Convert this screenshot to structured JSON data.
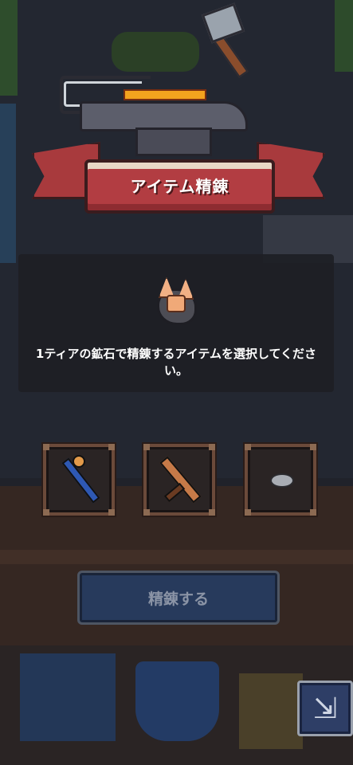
{
  "header": {
    "title": "アイテム精錬"
  },
  "panel": {
    "ore_icon": "copper-ore-icon",
    "message": "1ティアの鉱石で精錬するアイテムを選択してください。"
  },
  "slots": [
    {
      "icon": "wand-icon"
    },
    {
      "icon": "sword-icon"
    },
    {
      "icon": "coin-icon"
    }
  ],
  "actions": {
    "refine_label": "精錬する"
  },
  "corner_button": {
    "icon": "expand-arrow-icon",
    "glyph": "⇲"
  }
}
